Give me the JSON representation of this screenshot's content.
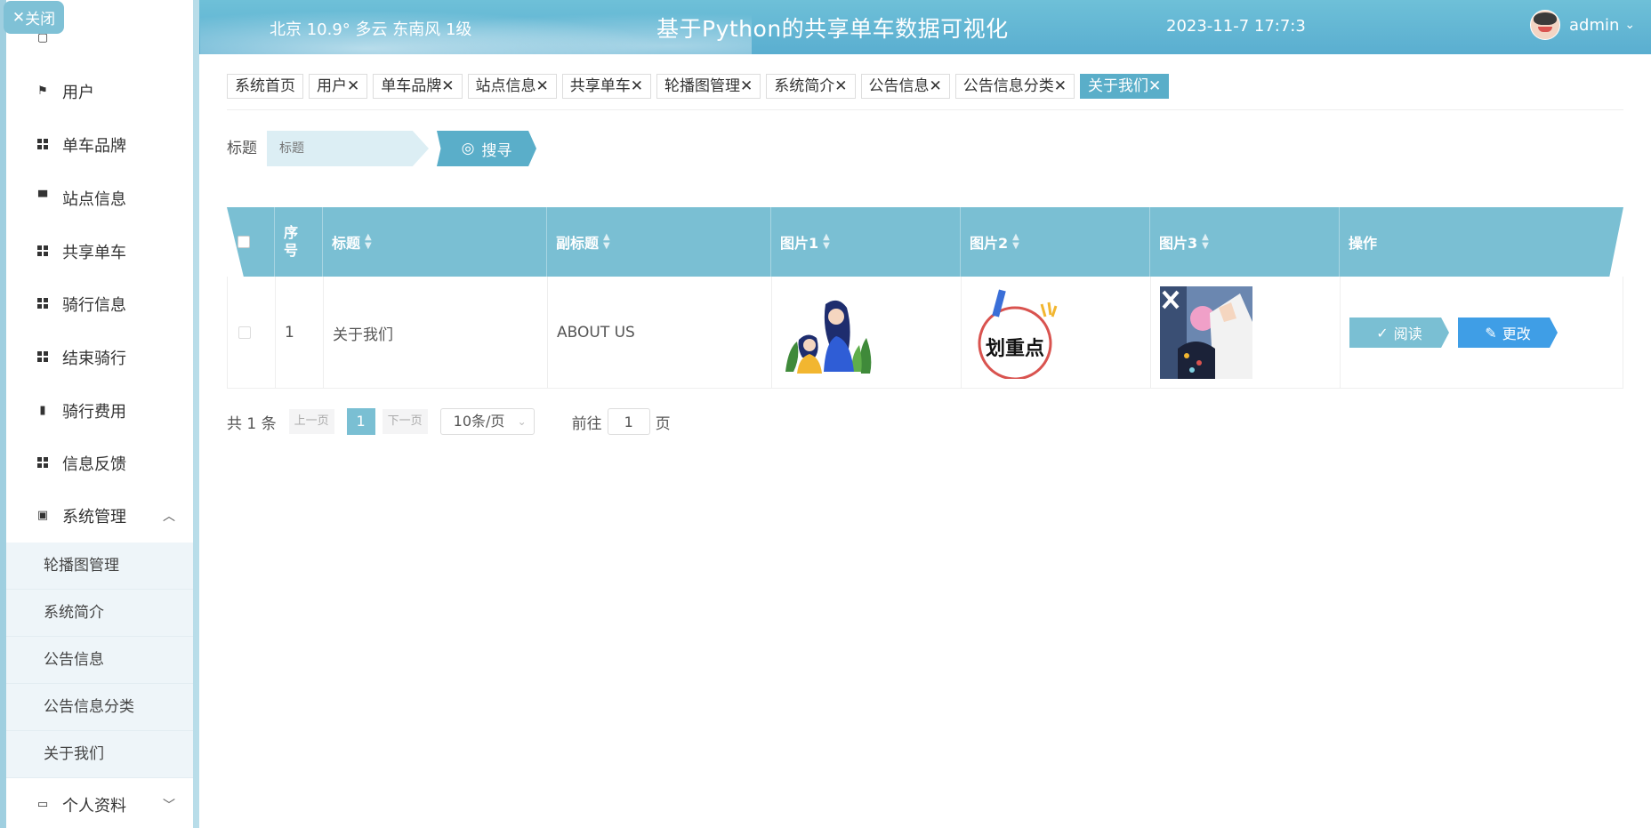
{
  "header": {
    "weather": "北京  10.9°  多云  东南风  1级",
    "title": "基于Python的共享单车数据可视化",
    "datetime": "2023-11-7 17:7:3",
    "username": "admin"
  },
  "sidebar": {
    "close_label": "关闭",
    "items": [
      {
        "label": "用户",
        "icon": "flag-icon"
      },
      {
        "label": "单车品牌",
        "icon": "grid-icon"
      },
      {
        "label": "站点信息",
        "icon": "monitor-icon"
      },
      {
        "label": "共享单车",
        "icon": "grid-icon"
      },
      {
        "label": "骑行信息",
        "icon": "grid-icon"
      },
      {
        "label": "结束骑行",
        "icon": "grid-icon"
      },
      {
        "label": "骑行费用",
        "icon": "clipboard-icon"
      },
      {
        "label": "信息反馈",
        "icon": "grid-icon"
      },
      {
        "label": "系统管理",
        "icon": "clipboard-x-icon"
      }
    ],
    "sub_items": [
      "轮播图管理",
      "系统简介",
      "公告信息",
      "公告信息分类",
      "关于我们"
    ],
    "profile_label": "个人资料"
  },
  "tabs": [
    "系统首页",
    "用户✕",
    "单车品牌✕",
    "站点信息✕",
    "共享单车✕",
    "轮播图管理✕",
    "系统简介✕",
    "公告信息✕",
    "公告信息分类✕",
    "关于我们✕"
  ],
  "search": {
    "label": "标题",
    "placeholder": "标题",
    "button_label": "搜寻"
  },
  "table": {
    "columns": [
      "序号",
      "标题",
      "副标题",
      "图片1",
      "图片2",
      "图片3",
      "操作"
    ],
    "rows": [
      {
        "index": "1",
        "title": "关于我们",
        "subtitle": "ABOUT US"
      }
    ],
    "read_label": "阅读",
    "edit_label": "更改",
    "pic2_text": "划重点"
  },
  "pagination": {
    "total": "共 1 条",
    "prev": "上一页",
    "current": "1",
    "next": "下一页",
    "page_size": "10条/页",
    "goto": "前往",
    "goto_value": "1",
    "suffix": "页"
  }
}
